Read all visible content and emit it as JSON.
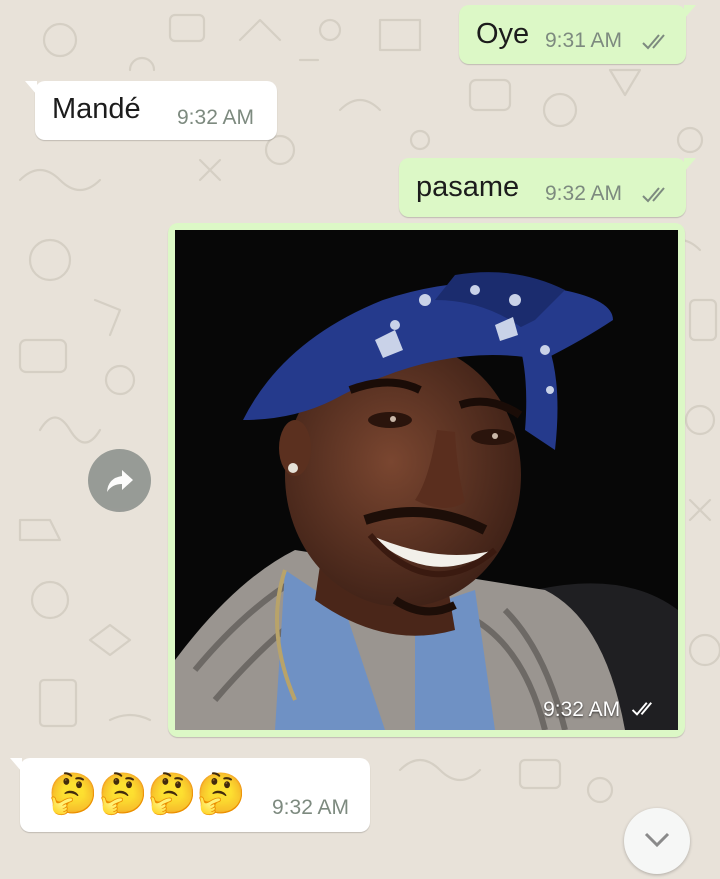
{
  "chat": {
    "messages": [
      {
        "id": "m1",
        "direction": "outgoing",
        "text": "Oye",
        "time": "9:31 AM",
        "status": "read"
      },
      {
        "id": "m2",
        "direction": "incoming",
        "text": "Mandé",
        "time": "9:32 AM"
      },
      {
        "id": "m3",
        "direction": "outgoing",
        "text": "pasame",
        "time": "9:32 AM",
        "status": "read"
      },
      {
        "id": "m4",
        "direction": "outgoing",
        "type": "image",
        "image_icon": "portrait-photo",
        "time": "9:32 AM",
        "status": "read"
      },
      {
        "id": "m5",
        "direction": "incoming",
        "text": "🤔🤔🤔🤔",
        "emojis": [
          "🤔",
          "🤔",
          "🤔",
          "🤔"
        ],
        "time": "9:32 AM"
      }
    ],
    "forward_icon": "forward-arrow-icon",
    "scroll_icon": "scroll-down-icon"
  },
  "colors": {
    "outgoing_bubble": "#dcf8c6",
    "incoming_bubble": "#ffffff",
    "wallpaper": "#e8e2d9",
    "read_ticks": "#7d8a7f"
  }
}
